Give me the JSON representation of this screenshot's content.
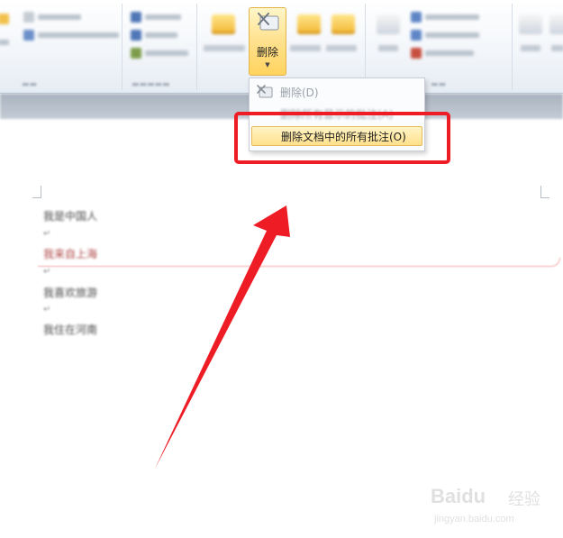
{
  "ribbon": {
    "delete_button_label": "删除"
  },
  "delete_menu": {
    "items": [
      {
        "label": "删除(D)",
        "enabled": false
      },
      {
        "label": "删除所有显示的批注(A)",
        "enabled": false
      },
      {
        "label": "删除文档中的所有批注(O)",
        "enabled": true,
        "highlighted": true
      }
    ]
  },
  "document": {
    "lines": [
      "我是中国人",
      "我来自上海",
      "我喜欢旅游",
      "我住在河南"
    ]
  },
  "watermark": {
    "brand": "Baidu",
    "cn": "经验",
    "url": "jingyan.baidu.com"
  },
  "colors": {
    "annotation_red": "#ee1c25",
    "highlight_fill": "#ffe18c",
    "highlight_border": "#e6b95b"
  }
}
